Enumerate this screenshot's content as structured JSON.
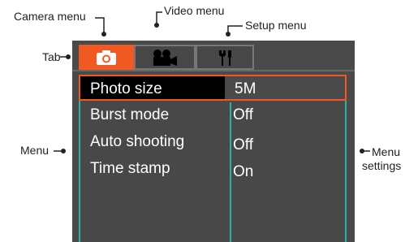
{
  "callouts": {
    "camera_menu": "Camera menu",
    "video_menu": "Video menu",
    "setup_menu": "Setup menu",
    "tab": "Tab",
    "menu": "Menu",
    "menu_settings_1": "Menu",
    "menu_settings_2": "settings"
  },
  "tabs": [
    {
      "name": "camera",
      "icon": "camera-icon",
      "active": true
    },
    {
      "name": "video",
      "icon": "video-camera-icon",
      "active": false
    },
    {
      "name": "setup",
      "icon": "wrench-screwdriver-icon",
      "active": false
    }
  ],
  "menu": {
    "items": [
      {
        "label": "Photo size",
        "value": "5M",
        "selected": true
      },
      {
        "label": "Burst mode",
        "value": "Off",
        "selected": false
      },
      {
        "label": "Auto shooting",
        "value": "Off",
        "selected": false
      },
      {
        "label": "Time stamp",
        "value": "On",
        "selected": false
      }
    ]
  },
  "colors": {
    "accent": "#f05a22",
    "teal": "#2ab0a8",
    "panel": "#4a4a4a"
  }
}
